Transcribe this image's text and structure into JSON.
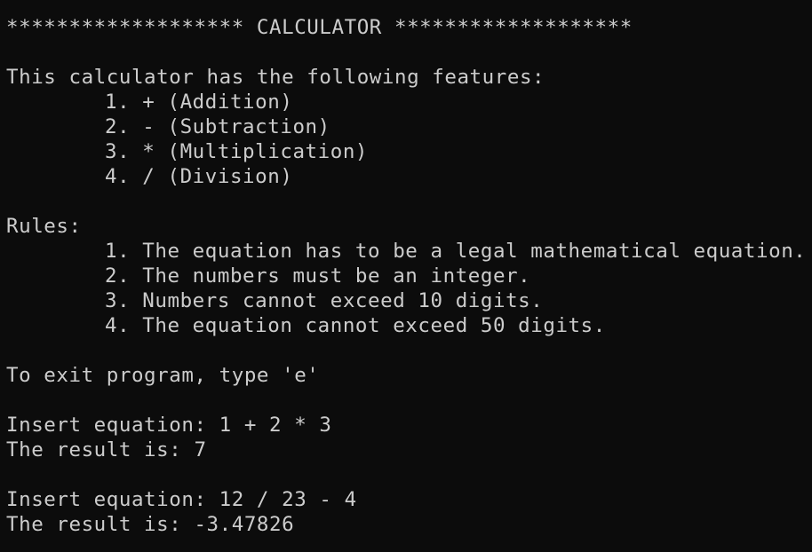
{
  "theme": {
    "background": "#0c0c0c",
    "foreground": "#cccccc"
  },
  "header": "******************* CALCULATOR *******************",
  "features": {
    "intro": "This calculator has the following features:",
    "items": [
      "1. + (Addition)",
      "2. - (Subtraction)",
      "3. * (Multiplication)",
      "4. / (Division)"
    ]
  },
  "rules": {
    "heading": "Rules:",
    "items": [
      "1. The equation has to be a legal mathematical equation.",
      "2. The numbers must be an integer.",
      "3. Numbers cannot exceed 10 digits.",
      "4. The equation cannot exceed 50 digits."
    ]
  },
  "exit_hint": "To exit program, type 'e'",
  "session": [
    {
      "prompt": "Insert equation: 1 + 2 * 3",
      "result": "The result is: 7"
    },
    {
      "prompt": "Insert equation: 12 / 23 - 4",
      "result": "The result is: -3.47826"
    }
  ]
}
